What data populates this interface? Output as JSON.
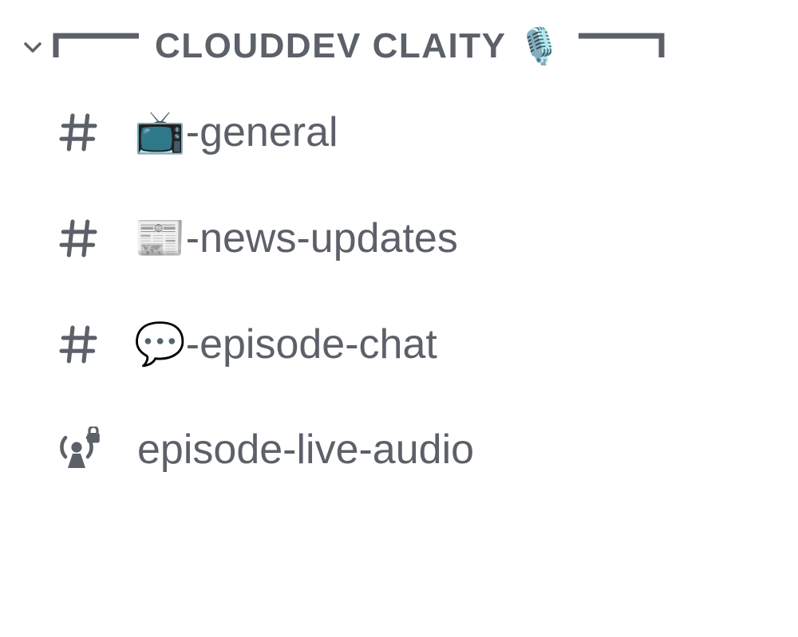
{
  "category": {
    "name": "CLOUDDEV CLAITY",
    "emoji": "🎙️"
  },
  "channels": [
    {
      "type": "text",
      "emoji": "📺",
      "name": "-general"
    },
    {
      "type": "text",
      "emoji": "📰",
      "name": "-news-updates"
    },
    {
      "type": "text",
      "emoji": "💬",
      "name": "-episode-chat"
    },
    {
      "type": "stage_locked",
      "emoji": "",
      "name": "episode-live-audio"
    }
  ],
  "colors": {
    "text": "#5c6068",
    "background": "#ffffff"
  }
}
